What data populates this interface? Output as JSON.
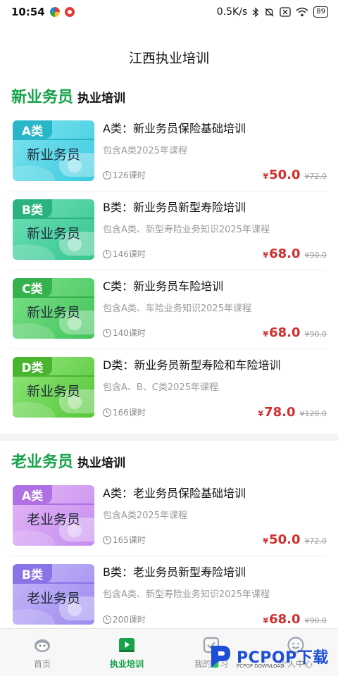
{
  "status_bar": {
    "time": "10:54",
    "speed": "0.5K/s",
    "battery": "89"
  },
  "header": {
    "title": "江西执业培训"
  },
  "sections": [
    {
      "title": "新业务员",
      "subtitle": "执业培训",
      "courses": [
        {
          "tag": "A类",
          "thumb_title": "新业务员",
          "theme": "cyan",
          "title": "A类：新业务员保险基础培训",
          "desc": "包含A类2025年课程",
          "hours": "126课时",
          "currency": "¥",
          "price": "50.0",
          "old_price": "¥72.0"
        },
        {
          "tag": "B类",
          "thumb_title": "新业务员",
          "theme": "teal",
          "title": "B类：新业务员新型寿险培训",
          "desc": "包含A类、新型寿险业务知识2025年课程",
          "hours": "146课时",
          "currency": "¥",
          "price": "68.0",
          "old_price": "¥90.0"
        },
        {
          "tag": "C类",
          "thumb_title": "新业务员",
          "theme": "green",
          "title": "C类：新业务员车险培训",
          "desc": "包含A类、车险业务知识2025年课程",
          "hours": "140课时",
          "currency": "¥",
          "price": "68.0",
          "old_price": "¥90.0"
        },
        {
          "tag": "D类",
          "thumb_title": "新业务员",
          "theme": "lime",
          "title": "D类：新业务员新型寿险和车险培训",
          "desc": "包含A、B、C类2025年课程",
          "hours": "166课时",
          "currency": "¥",
          "price": "78.0",
          "old_price": "¥120.0"
        }
      ]
    },
    {
      "title": "老业务员",
      "subtitle": "执业培训",
      "courses": [
        {
          "tag": "A类",
          "thumb_title": "老业务员",
          "theme": "violet",
          "title": "A类：老业务员保险基础培训",
          "desc": "包含A类2025年课程",
          "hours": "165课时",
          "currency": "¥",
          "price": "50.0",
          "old_price": "¥72.0"
        },
        {
          "tag": "B类",
          "thumb_title": "老业务员",
          "theme": "indigo",
          "title": "B类：老业务员新型寿险培训",
          "desc": "包含A类、新型寿险业务知识2025年课程",
          "hours": "200课时",
          "currency": "¥",
          "price": "68.0",
          "old_price": "¥90.0"
        }
      ]
    }
  ],
  "tabbar": {
    "items": [
      {
        "label": "首页",
        "icon": "home-face-icon"
      },
      {
        "label": "执业培训",
        "icon": "play-book-icon",
        "active": true
      },
      {
        "label": "我的学习",
        "icon": "check-square-icon"
      },
      {
        "label": "个人中心",
        "icon": "smile-icon"
      }
    ]
  },
  "watermark": {
    "text": "PCPOP下载",
    "sub": "PCPOP DOWNLOAD"
  },
  "colors": {
    "accent": "#16a34a",
    "price": "#d32f2f"
  }
}
